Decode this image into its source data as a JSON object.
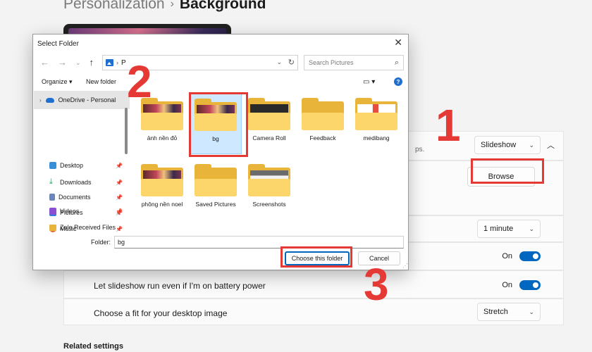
{
  "breadcrumb": {
    "parent": "Personalization",
    "separator": "›",
    "current": "Background"
  },
  "settings": {
    "background_type": {
      "value": "Slideshow",
      "description_fragment": "ps."
    },
    "browse": {
      "label": "Browse"
    },
    "change_every": {
      "value": "1 minute"
    },
    "shuffle": {
      "state": "On"
    },
    "battery": {
      "label": "Let slideshow run even if I'm on battery power",
      "state": "On"
    },
    "fit": {
      "label": "Choose a fit for your desktop image",
      "value": "Stretch"
    },
    "related": "Related settings"
  },
  "dialog": {
    "title": "Select Folder",
    "address_fragment": "P",
    "search_placeholder": "Search Pictures",
    "toolbar": {
      "organize": "Organize ▾",
      "new_folder": "New folder"
    },
    "nav": {
      "onedrive": "OneDrive - Personal",
      "items": [
        {
          "label": "Desktop",
          "color": "#3a8fd9"
        },
        {
          "label": "Downloads",
          "color": "#2f9e5e"
        },
        {
          "label": "Documents",
          "color": "#6b86b8"
        },
        {
          "label": "Pictures",
          "color": "#2f7fd9"
        },
        {
          "label": "Music",
          "color": "#e8633b"
        },
        {
          "label": "Videos",
          "color": "#8a4fd3"
        },
        {
          "label": "Zalo Received Files",
          "color": "#e9b43a"
        }
      ]
    },
    "folders": [
      {
        "name": "ảnh nền đỏ",
        "thumb": "photo"
      },
      {
        "name": "bg",
        "thumb": "photo",
        "selected": true
      },
      {
        "name": "Camera Roll",
        "thumb": "dark"
      },
      {
        "name": "Feedback",
        "thumb": "none"
      },
      {
        "name": "medibang",
        "thumb": "doc"
      },
      {
        "name": "phông nền noel",
        "thumb": "photo"
      },
      {
        "name": "Saved Pictures",
        "thumb": "none"
      },
      {
        "name": "Screenshots",
        "thumb": "screen"
      }
    ],
    "folder_label": "Folder:",
    "folder_value": "bg",
    "choose_label": "Choose this folder",
    "cancel_label": "Cancel"
  },
  "annotations": [
    "1",
    "2",
    "3"
  ],
  "colors": {
    "accent": "#0067c0",
    "highlight": "#e53935",
    "folder": "#fcd66b"
  }
}
